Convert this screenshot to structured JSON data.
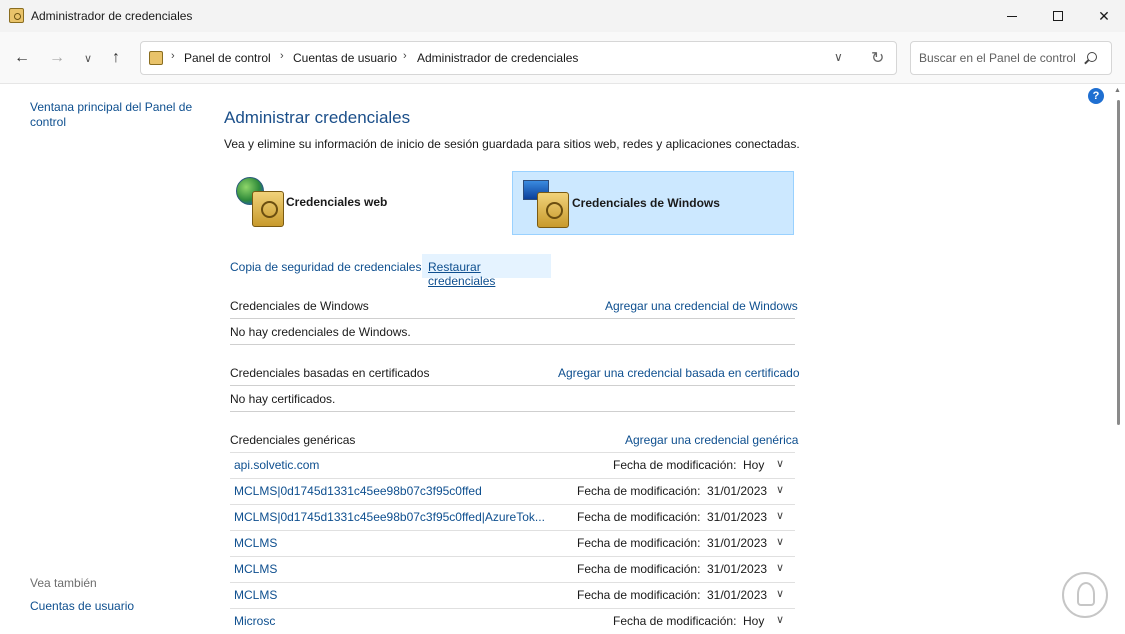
{
  "window": {
    "title": "Administrador de credenciales",
    "icon": "credential-manager-icon"
  },
  "nav": {
    "breadcrumb": [
      "Panel de control",
      "Cuentas de usuario",
      "Administrador de credenciales"
    ],
    "search_placeholder": "Buscar en el Panel de control"
  },
  "left": {
    "home_link": "Ventana principal del Panel de control",
    "see_also": "Vea también",
    "user_accounts": "Cuentas de usuario"
  },
  "main": {
    "heading": "Administrar credenciales",
    "subtitle": "Vea y elimine su información de inicio de sesión guardada para sitios web, redes y aplicaciones conectadas.",
    "tiles": {
      "web": "Credenciales web",
      "windows": "Credenciales de Windows"
    },
    "backup_link": "Copia de seguridad de credenciales",
    "restore_link": "Restaurar credenciales",
    "windows_section": {
      "title": "Credenciales de Windows",
      "add": "Agregar una credencial de Windows",
      "empty": "No hay credenciales de Windows."
    },
    "cert_section": {
      "title": "Credenciales basadas en certificados",
      "add": "Agregar una credencial basada en certificado",
      "empty": "No hay certificados."
    },
    "generic_section": {
      "title": "Credenciales genéricas",
      "add": "Agregar una credencial genérica",
      "rows": [
        {
          "name": "api.solvetic.com",
          "modified_label": "Fecha de modificación:",
          "date": "Hoy"
        },
        {
          "name": "MCLMS|0d1745d1331c45ee98b07c3f95c0ffed",
          "modified_label": "Fecha de modificación:",
          "date": "31/01/2023"
        },
        {
          "name": "MCLMS|0d1745d1331c45ee98b07c3f95c0ffed|AzureTok...",
          "modified_label": "Fecha de modificación:",
          "date": "31/01/2023"
        },
        {
          "name": "MCLMS",
          "modified_label": "Fecha de modificación:",
          "date": "31/01/2023"
        },
        {
          "name": "MCLMS",
          "modified_label": "Fecha de modificación:",
          "date": "31/01/2023"
        },
        {
          "name": "MCLMS",
          "modified_label": "Fecha de modificación:",
          "date": "31/01/2023"
        },
        {
          "name": "Microsc",
          "modified_label": "Fecha de modificación:",
          "date": "Hoy"
        }
      ]
    }
  },
  "colors": {
    "link": "#0e4f8f",
    "heading": "#1b4f8a",
    "selected_tile": "#cce8ff"
  }
}
